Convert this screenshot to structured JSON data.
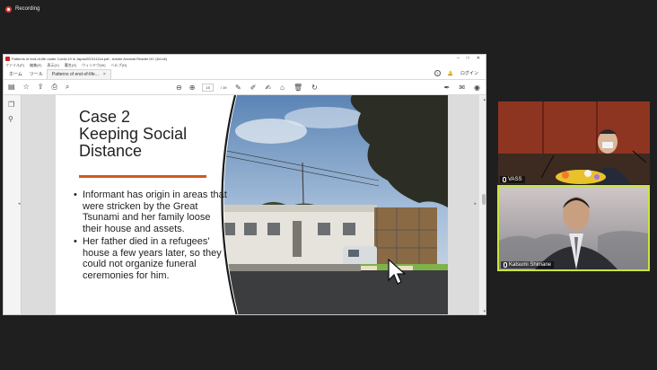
{
  "recording": {
    "label": "Recording",
    "color": "#e23b3b"
  },
  "window": {
    "title": "Patterns of end-of-life under Covid-19 in Japan20211111a.pdf - Adobe Acrobat Reader DC (64-bit)",
    "controls": {
      "minimize": "–",
      "maximize": "□",
      "close": "✕"
    }
  },
  "menubar": {
    "items": [
      "ファイル(F)",
      "編集(E)",
      "表示(V)",
      "署名(S)",
      "ウィンドウ(W)",
      "ヘルプ(H)"
    ]
  },
  "tabs": [
    {
      "label": "ホーム"
    },
    {
      "label": "ツール"
    },
    {
      "label": "Patterns of end-of-life...",
      "active": true,
      "close": "×"
    }
  ],
  "tab_right": {
    "help": "?",
    "login": "ログイン"
  },
  "toolbar": {
    "page_current": "15",
    "page_total": "/ 19"
  },
  "slide": {
    "title": "Case 2\nKeeping Social\nDistance",
    "accent_color": "#d05a1e",
    "bullets": [
      "Informant has origin in areas that were stricken by the Great Tsunami and her family loose their house and assets.",
      "Her father died in a refugees' house a few years later, so they could not organize funeral ceremonies for him."
    ]
  },
  "participants": [
    {
      "name": "VASS"
    },
    {
      "name": "Katsumi Shimane",
      "active_speaker": true,
      "highlight_color": "#c8e63a"
    }
  ]
}
